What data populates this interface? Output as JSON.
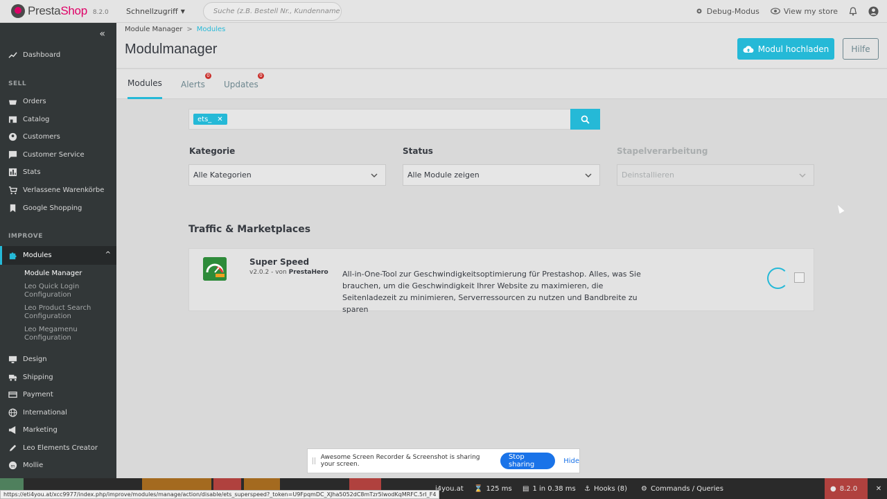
{
  "header": {
    "logo_prefix": "Presta",
    "logo_suffix": "Shop",
    "version": "8.2.0",
    "quick_access": "Schnellzugriff",
    "search_placeholder": "Suche (z.B. Bestell Nr., Kundenname ...",
    "debug_mode": "Debug-Modus",
    "view_store": "View my store"
  },
  "sidebar": {
    "dashboard": "Dashboard",
    "sell_label": "SELL",
    "sell_items": [
      "Orders",
      "Catalog",
      "Customers",
      "Customer Service",
      "Stats",
      "Verlassene Warenkörbe",
      "Google Shopping"
    ],
    "improve_label": "IMPROVE",
    "modules": "Modules",
    "modules_sub": [
      "Module Manager",
      "Leo Quick Login Configuration",
      "Leo Product Search Configuration",
      "Leo Megamenu Configuration"
    ],
    "improve_items": [
      "Design",
      "Shipping",
      "Payment",
      "International",
      "Marketing",
      "Leo Elements Creator",
      "Mollie"
    ]
  },
  "page": {
    "breadcrumb_root": "Module Manager",
    "breadcrumb_current": "Modules",
    "title": "Modulmanager",
    "upload_button": "Modul hochladen",
    "help_button": "Hilfe"
  },
  "tabs": [
    {
      "label": "Modules",
      "badge": ""
    },
    {
      "label": "Alerts",
      "badge": "0"
    },
    {
      "label": "Updates",
      "badge": "0"
    }
  ],
  "filter": {
    "chip": "ets_",
    "category_label": "Kategorie",
    "category_value": "Alle Kategorien",
    "status_label": "Status",
    "status_value": "Alle Module zeigen",
    "bulk_label": "Stapelverarbeitung",
    "bulk_value": "Deinstallieren"
  },
  "category": {
    "title": "Traffic & Marketplaces",
    "module": {
      "name": "Super Speed",
      "version": "v2.0.2 - von",
      "author": "PrestaHero",
      "description": "All-in-One-Tool zur Geschwindigkeitsoptimierung für Prestashop. Alles, was Sie brauchen, um die Geschwindigkeit Ihrer Website zu maximieren, die Seitenladezeit zu minimieren, Serverressourcen zu nutzen und Bandbreite zu sparen"
    }
  },
  "share_bar": {
    "message": "Awesome Screen Recorder & Screenshot is sharing your screen.",
    "stop": "Stop sharing",
    "hide": "Hide"
  },
  "debug_bar": {
    "status_url": "https://eti4you.at/xcc9977/index.php/improve/modules/manage/action/disable/ets_superspeed?_token=U9FpqmDC_XJha5052dC8mTzr5lwodKqMRFC.5rI_F4",
    "domain": "j4you.at",
    "time": "125 ms",
    "queries": "1 in 0.38 ms",
    "hooks": "Hooks (8)",
    "commands": "Commands / Queries",
    "version": "8.2.0"
  },
  "colors": {
    "accent": "#25b9d7",
    "sidebar_bg": "#323738",
    "badge": "#c9302c"
  }
}
